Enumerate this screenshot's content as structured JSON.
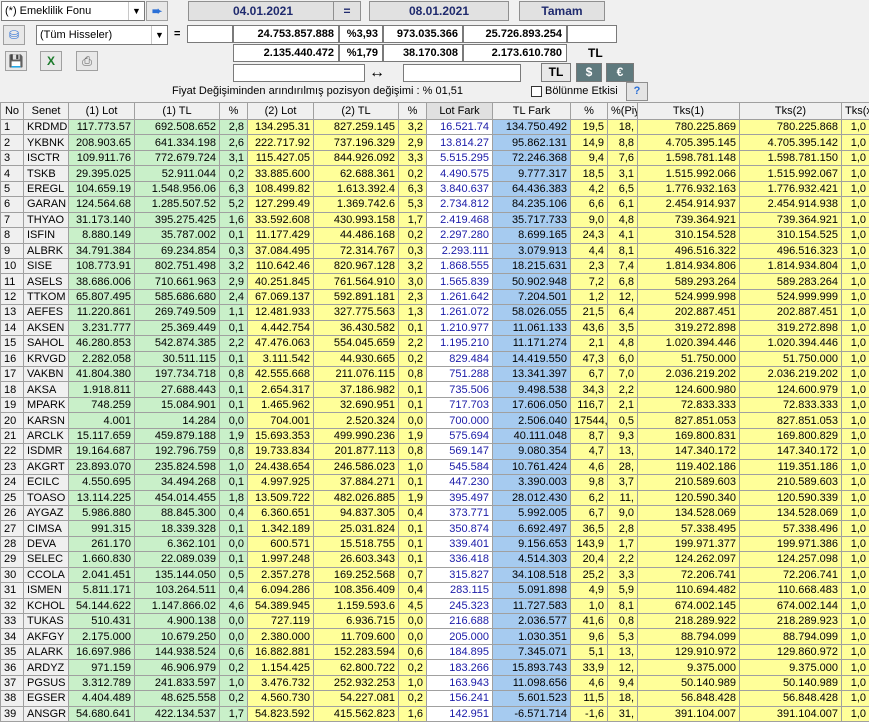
{
  "toolbar": {
    "fund_select": "(*) Emeklilik Fonu",
    "stock_filter": "(Tüm Hisseler)",
    "date_from": "04.01.2021",
    "equals": "=",
    "date_to": "08.01.2021",
    "ok_button": "Tamam",
    "plus": "=",
    "row1": {
      "v1": "24.753.857.888",
      "pct1": "%3,93",
      "v2": "973.035.366",
      "v3": "25.726.893.254"
    },
    "row2": {
      "v1": "2.135.440.472",
      "pct1": "%1,79",
      "v2": "38.170.308",
      "v3": "2.173.610.780",
      "unit": "TL"
    },
    "arrows": "↔",
    "currency_tl": "TL",
    "currency_usd": "$",
    "currency_eur": "€",
    "price_change_note": "Fiyat Değişiminden arındırılmış pozisyon değişimi : % 01,51",
    "split_effect_label": "Bölünme Etkisi",
    "help": "?"
  },
  "icons": {
    "save": "save-icon",
    "excel": "excel-icon",
    "print": "print-icon",
    "portfolio": "portfolio-icon",
    "go": "arrow-right-icon"
  },
  "colors": {
    "green": "#c9f0c9",
    "yellow": "#ffff99",
    "blue": "#a6cbf0"
  },
  "table": {
    "headers": [
      "No",
      "Senet",
      "(1) Lot",
      "(1) TL",
      "%",
      "(2) Lot",
      "(2) TL",
      "%",
      "Lot Fark",
      "TL Fark",
      "%",
      "%(Piy",
      "Tks(1)",
      "Tks(2)",
      "Tks(x"
    ],
    "rows": [
      [
        "1",
        "KRDMD",
        "117.773.57",
        "692.508.652",
        "2,8",
        "134.295.31",
        "827.259.145",
        "3,2",
        "16.521.74",
        "134.750.492",
        "19,5",
        "18,",
        "780.225.869",
        "780.225.868",
        "1,0"
      ],
      [
        "2",
        "YKBNK",
        "208.903.65",
        "641.334.198",
        "2,6",
        "222.717.92",
        "737.196.329",
        "2,9",
        "13.814.27",
        "95.862.131",
        "14,9",
        "8,8",
        "4.705.395.145",
        "4.705.395.142",
        "1,0"
      ],
      [
        "3",
        "ISCTR",
        "109.911.76",
        "772.679.724",
        "3,1",
        "115.427.05",
        "844.926.092",
        "3,3",
        "5.515.295",
        "72.246.368",
        "9,4",
        "7,6",
        "1.598.781.148",
        "1.598.781.150",
        "1,0"
      ],
      [
        "4",
        "TSKB",
        "29.395.025",
        "52.911.044",
        "0,2",
        "33.885.600",
        "62.688.361",
        "0,2",
        "4.490.575",
        "9.777.317",
        "18,5",
        "3,1",
        "1.515.992.066",
        "1.515.992.067",
        "1,0"
      ],
      [
        "5",
        "EREGL",
        "104.659.19",
        "1.548.956.06",
        "6,3",
        "108.499.82",
        "1.613.392.4",
        "6,3",
        "3.840.637",
        "64.436.383",
        "4,2",
        "6,5",
        "1.776.932.163",
        "1.776.932.421",
        "1,0"
      ],
      [
        "6",
        "GARAN",
        "124.564.68",
        "1.285.507.52",
        "5,2",
        "127.299.49",
        "1.369.742.6",
        "5,3",
        "2.734.812",
        "84.235.106",
        "6,6",
        "6,1",
        "2.454.914.937",
        "2.454.914.938",
        "1,0"
      ],
      [
        "7",
        "THYAO",
        "31.173.140",
        "395.275.425",
        "1,6",
        "33.592.608",
        "430.993.158",
        "1,7",
        "2.419.468",
        "35.717.733",
        "9,0",
        "4,8",
        "739.364.921",
        "739.364.921",
        "1,0"
      ],
      [
        "8",
        "ISFIN",
        "8.880.149",
        "35.787.002",
        "0,1",
        "11.177.429",
        "44.486.168",
        "0,2",
        "2.297.280",
        "8.699.165",
        "24,3",
        "4,1",
        "310.154.528",
        "310.154.525",
        "1,0"
      ],
      [
        "9",
        "ALBRK",
        "34.791.384",
        "69.234.854",
        "0,3",
        "37.084.495",
        "72.314.767",
        "0,3",
        "2.293.111",
        "3.079.913",
        "4,4",
        "8,1",
        "496.516.322",
        "496.516.323",
        "1,0"
      ],
      [
        "10",
        "SISE",
        "108.773.91",
        "802.751.498",
        "3,2",
        "110.642.46",
        "820.967.128",
        "3,2",
        "1.868.555",
        "18.215.631",
        "2,3",
        "7,4",
        "1.814.934.806",
        "1.814.934.804",
        "1,0"
      ],
      [
        "11",
        "ASELS",
        "38.686.006",
        "710.661.963",
        "2,9",
        "40.251.845",
        "761.564.910",
        "3,0",
        "1.565.839",
        "50.902.948",
        "7,2",
        "6,8",
        "589.293.264",
        "589.283.264",
        "1,0"
      ],
      [
        "12",
        "TTKOM",
        "65.807.495",
        "585.686.680",
        "2,4",
        "67.069.137",
        "592.891.181",
        "2,3",
        "1.261.642",
        "7.204.501",
        "1,2",
        "12,",
        "524.999.998",
        "524.999.999",
        "1,0"
      ],
      [
        "13",
        "AEFES",
        "11.220.861",
        "269.749.509",
        "1,1",
        "12.481.933",
        "327.775.563",
        "1,3",
        "1.261.072",
        "58.026.055",
        "21,5",
        "6,4",
        "202.887.451",
        "202.887.451",
        "1,0"
      ],
      [
        "14",
        "AKSEN",
        "3.231.777",
        "25.369.449",
        "0,1",
        "4.442.754",
        "36.430.582",
        "0,1",
        "1.210.977",
        "11.061.133",
        "43,6",
        "3,5",
        "319.272.898",
        "319.272.898",
        "1,0"
      ],
      [
        "15",
        "SAHOL",
        "46.280.853",
        "542.874.385",
        "2,2",
        "47.476.063",
        "554.045.659",
        "2,2",
        "1.195.210",
        "11.171.274",
        "2,1",
        "4,8",
        "1.020.394.446",
        "1.020.394.446",
        "1,0"
      ],
      [
        "16",
        "KRVGD",
        "2.282.058",
        "30.511.115",
        "0,1",
        "3.111.542",
        "44.930.665",
        "0,2",
        "829.484",
        "14.419.550",
        "47,3",
        "6,0",
        "51.750.000",
        "51.750.000",
        "1,0"
      ],
      [
        "17",
        "VAKBN",
        "41.804.380",
        "197.734.718",
        "0,8",
        "42.555.668",
        "211.076.115",
        "0,8",
        "751.288",
        "13.341.397",
        "6,7",
        "7,0",
        "2.036.219.202",
        "2.036.219.202",
        "1,0"
      ],
      [
        "18",
        "AKSA",
        "1.918.811",
        "27.688.443",
        "0,1",
        "2.654.317",
        "37.186.982",
        "0,1",
        "735.506",
        "9.498.538",
        "34,3",
        "2,2",
        "124.600.980",
        "124.600.979",
        "1,0"
      ],
      [
        "19",
        "MPARK",
        "748.259",
        "15.084.901",
        "0,1",
        "1.465.962",
        "32.690.951",
        "0,1",
        "717.703",
        "17.606.050",
        "116,7",
        "2,1",
        "72.833.333",
        "72.833.333",
        "1,0"
      ],
      [
        "20",
        "KARSN",
        "4.001",
        "14.284",
        "0,0",
        "704.001",
        "2.520.324",
        "0,0",
        "700.000",
        "2.506.040",
        "17544,",
        "0,5",
        "827.851.053",
        "827.851.053",
        "1,0"
      ],
      [
        "21",
        "ARCLK",
        "15.117.659",
        "459.879.188",
        "1,9",
        "15.693.353",
        "499.990.236",
        "1,9",
        "575.694",
        "40.111.048",
        "8,7",
        "9,3",
        "169.800.831",
        "169.800.829",
        "1,0"
      ],
      [
        "22",
        "ISDMR",
        "19.164.687",
        "192.796.759",
        "0,8",
        "19.733.834",
        "201.877.113",
        "0,8",
        "569.147",
        "9.080.354",
        "4,7",
        "13,",
        "147.340.172",
        "147.340.172",
        "1,0"
      ],
      [
        "23",
        "AKGRT",
        "23.893.070",
        "235.824.598",
        "1,0",
        "24.438.654",
        "246.586.023",
        "1,0",
        "545.584",
        "10.761.424",
        "4,6",
        "28,",
        "119.402.186",
        "119.351.186",
        "1,0"
      ],
      [
        "24",
        "ECILC",
        "4.550.695",
        "34.494.268",
        "0,1",
        "4.997.925",
        "37.884.271",
        "0,1",
        "447.230",
        "3.390.003",
        "9,8",
        "3,7",
        "210.589.603",
        "210.589.603",
        "1,0"
      ],
      [
        "25",
        "TOASO",
        "13.114.225",
        "454.014.455",
        "1,8",
        "13.509.722",
        "482.026.885",
        "1,9",
        "395.497",
        "28.012.430",
        "6,2",
        "11,",
        "120.590.340",
        "120.590.339",
        "1,0"
      ],
      [
        "26",
        "AYGAZ",
        "5.986.880",
        "88.845.300",
        "0,4",
        "6.360.651",
        "94.837.305",
        "0,4",
        "373.771",
        "5.992.005",
        "6,7",
        "9,0",
        "134.528.069",
        "134.528.069",
        "1,0"
      ],
      [
        "27",
        "CIMSA",
        "991.315",
        "18.339.328",
        "0,1",
        "1.342.189",
        "25.031.824",
        "0,1",
        "350.874",
        "6.692.497",
        "36,5",
        "2,8",
        "57.338.495",
        "57.338.496",
        "1,0"
      ],
      [
        "28",
        "DEVA",
        "261.170",
        "6.362.101",
        "0,0",
        "600.571",
        "15.518.755",
        "0,1",
        "339.401",
        "9.156.653",
        "143,9",
        "1,7",
        "199.971.377",
        "199.971.386",
        "1,0"
      ],
      [
        "29",
        "SELEC",
        "1.660.830",
        "22.089.039",
        "0,1",
        "1.997.248",
        "26.603.343",
        "0,1",
        "336.418",
        "4.514.303",
        "20,4",
        "2,2",
        "124.262.097",
        "124.257.098",
        "1,0"
      ],
      [
        "30",
        "CCOLA",
        "2.041.451",
        "135.144.050",
        "0,5",
        "2.357.278",
        "169.252.568",
        "0,7",
        "315.827",
        "34.108.518",
        "25,2",
        "3,3",
        "72.206.741",
        "72.206.741",
        "1,0"
      ],
      [
        "31",
        "ISMEN",
        "5.811.171",
        "103.264.511",
        "0,4",
        "6.094.286",
        "108.356.409",
        "0,4",
        "283.115",
        "5.091.898",
        "4,9",
        "5,9",
        "110.694.482",
        "110.668.483",
        "1,0"
      ],
      [
        "32",
        "KCHOL",
        "54.144.622",
        "1.147.866.02",
        "4,6",
        "54.389.945",
        "1.159.593.6",
        "4,5",
        "245.323",
        "11.727.583",
        "1,0",
        "8,1",
        "674.002.145",
        "674.002.144",
        "1,0"
      ],
      [
        "33",
        "TUKAS",
        "510.431",
        "4.900.138",
        "0,0",
        "727.119",
        "6.936.715",
        "0,0",
        "216.688",
        "2.036.577",
        "41,6",
        "0,8",
        "218.289.922",
        "218.289.923",
        "1,0"
      ],
      [
        "34",
        "AKFGY",
        "2.175.000",
        "10.679.250",
        "0,0",
        "2.380.000",
        "11.709.600",
        "0,0",
        "205.000",
        "1.030.351",
        "9,6",
        "5,3",
        "88.794.099",
        "88.794.099",
        "1,0"
      ],
      [
        "35",
        "ALARK",
        "16.697.986",
        "144.938.524",
        "0,6",
        "16.882.881",
        "152.283.594",
        "0,6",
        "184.895",
        "7.345.071",
        "5,1",
        "13,",
        "129.910.972",
        "129.860.972",
        "1,0"
      ],
      [
        "36",
        "ARDYZ",
        "971.159",
        "46.906.979",
        "0,2",
        "1.154.425",
        "62.800.722",
        "0,2",
        "183.266",
        "15.893.743",
        "33,9",
        "12,",
        "9.375.000",
        "9.375.000",
        "1,0"
      ],
      [
        "37",
        "PGSUS",
        "3.312.789",
        "241.833.597",
        "1,0",
        "3.476.732",
        "252.932.253",
        "1,0",
        "163.943",
        "11.098.656",
        "4,6",
        "9,4",
        "50.140.989",
        "50.140.989",
        "1,0"
      ],
      [
        "38",
        "EGSER",
        "4.404.489",
        "48.625.558",
        "0,2",
        "4.560.730",
        "54.227.081",
        "0,2",
        "156.241",
        "5.601.523",
        "11,5",
        "18,",
        "56.848.428",
        "56.848.428",
        "1,0"
      ],
      [
        "39",
        "ANSGR",
        "54.680.641",
        "422.134.537",
        "1,7",
        "54.823.592",
        "415.562.823",
        "1,6",
        "142.951",
        "-6.571.714",
        "-1,6",
        "31,",
        "391.104.007",
        "391.104.007",
        "1,0"
      ]
    ]
  }
}
